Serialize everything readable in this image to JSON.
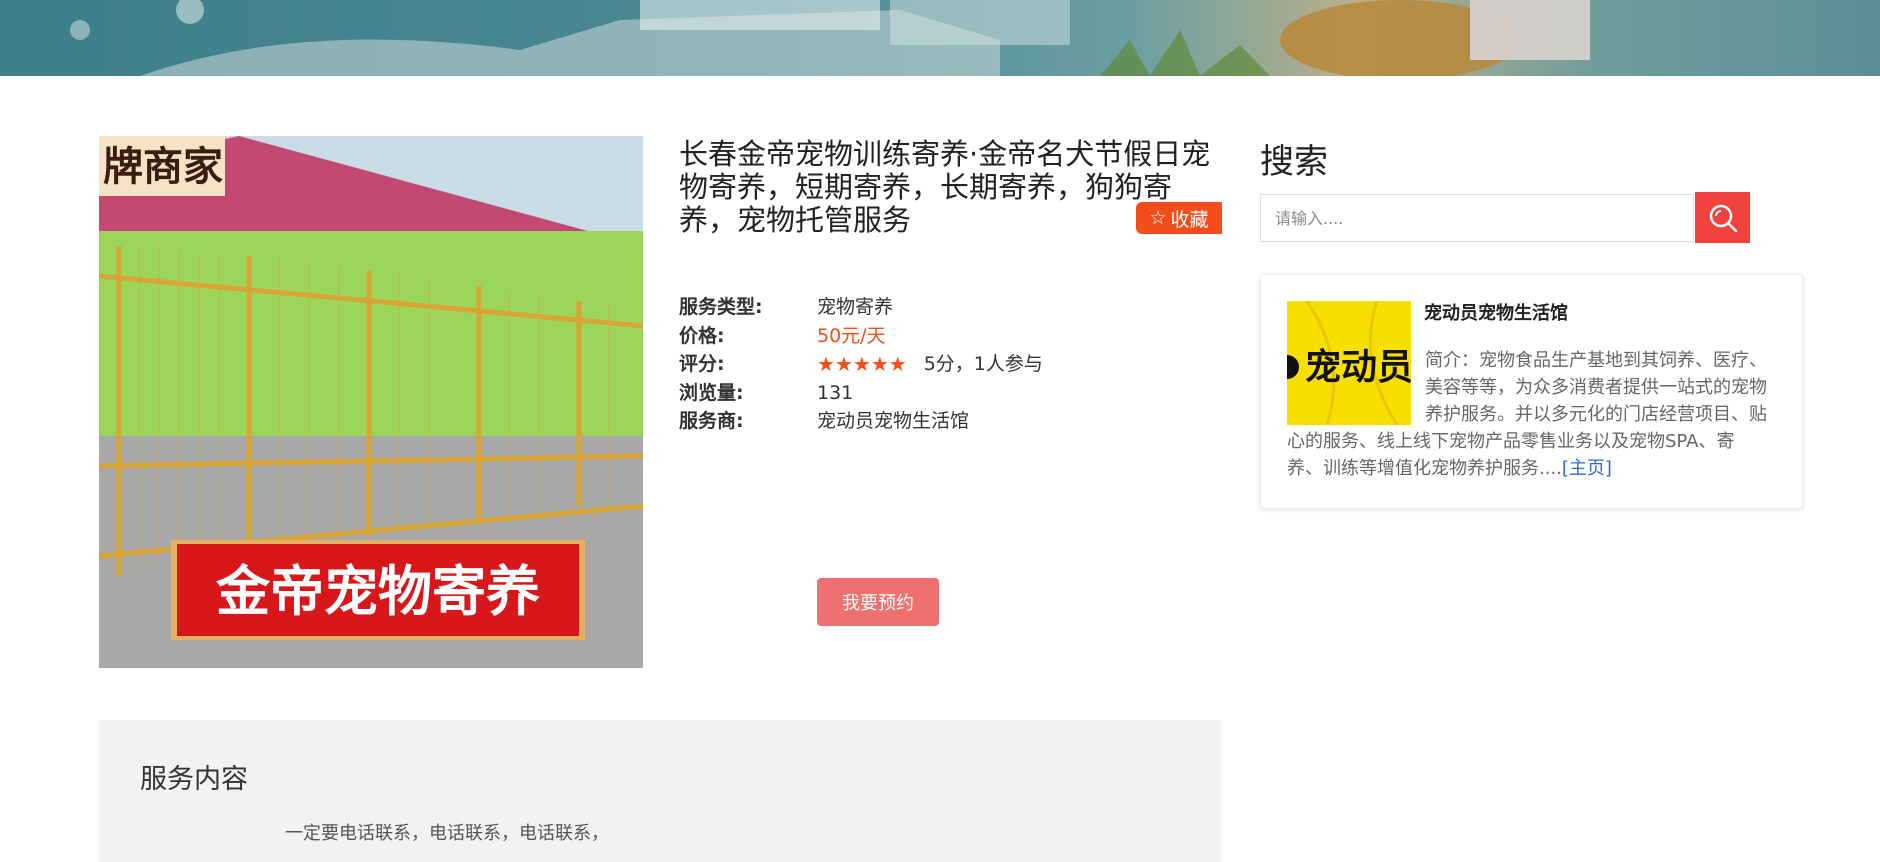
{
  "service": {
    "title": "长春金帝宠物训练寄养·金帝名犬节假日宠物寄养，短期寄养，长期寄养，狗狗寄养，宠物托管服务",
    "favorite_label": "收藏",
    "image_caption": "金帝宠物寄养",
    "image_corner_text": "牌商家",
    "fields": {
      "type_label": "服务类型:",
      "type_value": "宠物寄养",
      "price_label": "价格:",
      "price_value": "50元/天",
      "rating_label": "评分:",
      "rating_stars": 5,
      "rating_text": "5分，1人参与",
      "views_label": "浏览量:",
      "views_value": "131",
      "provider_label": "服务商:",
      "provider_value": "宠动员宠物生活馆"
    },
    "book_label": "我要预约"
  },
  "sidebar": {
    "search_heading": "搜索",
    "search_placeholder": "请输入....",
    "shop": {
      "logo_text": "宠动员",
      "name": "宠动员宠物生活馆",
      "description": "简介：宠物食品生产基地到其饲养、医疗、美容等等，为众多消费者提供一站式的宠物养护服务。并以多元化的门店经营项目、贴心的服务、线上线下宠物产品零售业务以及宠物SPA、寄养、训练等增值化宠物养护服务....",
      "homepage_link": "[主页]"
    }
  },
  "content": {
    "heading": "服务内容",
    "text": "一定要电话联系，电话联系，电话联系，"
  },
  "colors": {
    "accent": "#f24d1a",
    "book_button": "#f07070",
    "search_button": "#f2423e",
    "banner": "#4a8995"
  }
}
